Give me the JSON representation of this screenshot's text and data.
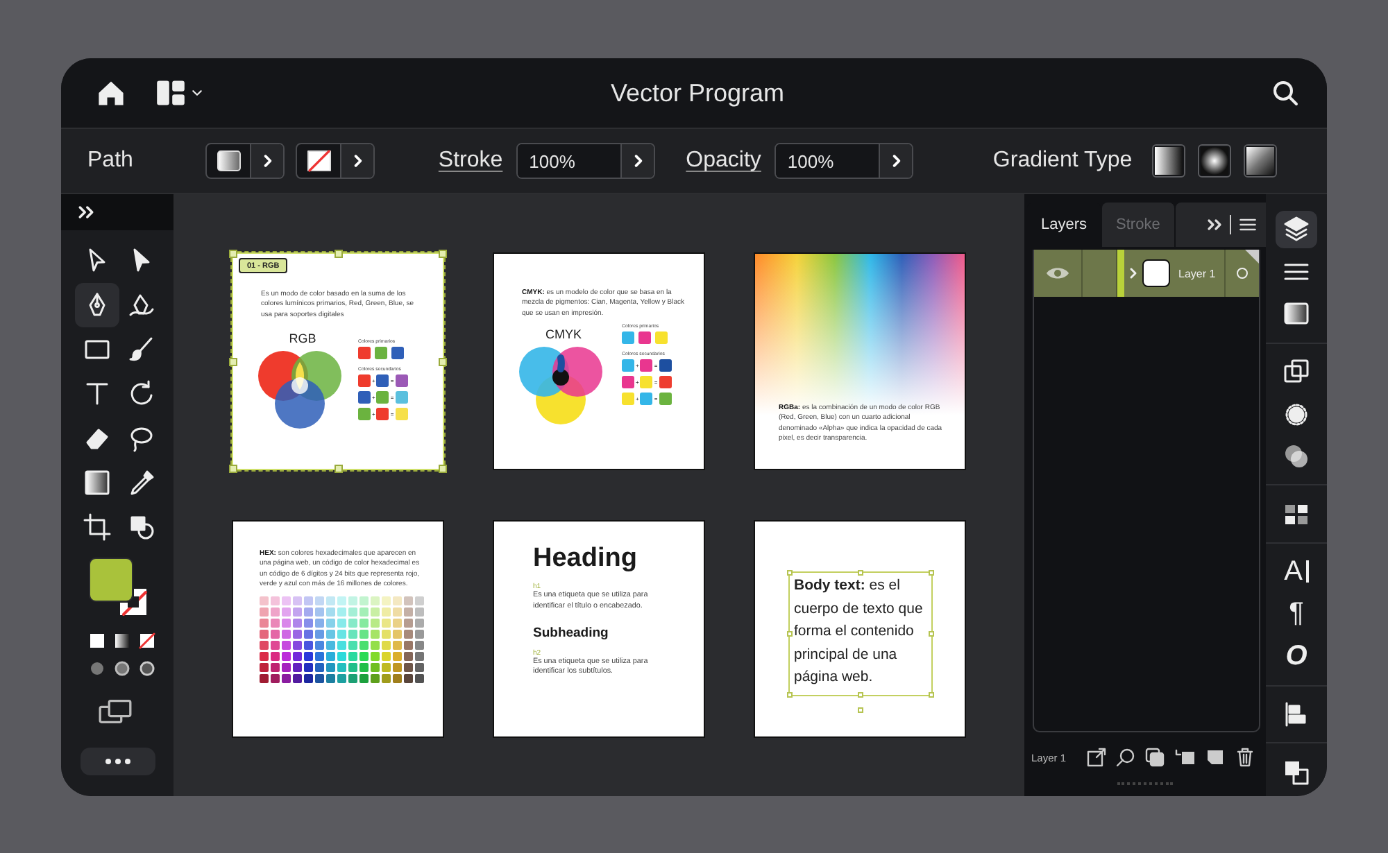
{
  "window": {
    "title": "Vector Program"
  },
  "toolbar": {
    "path_label": "Path",
    "stroke_label": "Stroke",
    "stroke_value": "100%",
    "opacity_label": "Opacity",
    "opacity_value": "100%",
    "gradient_type_label": "Gradient Type",
    "gradient_types": [
      {
        "kind": "linear"
      },
      {
        "kind": "radial"
      },
      {
        "kind": "angular"
      }
    ]
  },
  "tools": [
    {
      "kind": "select",
      "selected": false
    },
    {
      "kind": "direct-select",
      "selected": false
    },
    {
      "kind": "pen",
      "selected": true
    },
    {
      "kind": "curvature",
      "selected": false
    },
    {
      "kind": "rectangle",
      "selected": false
    },
    {
      "kind": "brush",
      "selected": false
    },
    {
      "kind": "type",
      "selected": false
    },
    {
      "kind": "rotate",
      "selected": false
    },
    {
      "kind": "eraser",
      "selected": false
    },
    {
      "kind": "lasso",
      "selected": false
    },
    {
      "kind": "gradient",
      "selected": false
    },
    {
      "kind": "eyedropper",
      "selected": false
    },
    {
      "kind": "crop",
      "selected": false
    },
    {
      "kind": "shape-builder",
      "selected": false
    }
  ],
  "artboards": [
    {
      "kind": "rgb",
      "selected": true,
      "badge": "01 - RGB",
      "text": "Es un modo de color basado en la suma de los colores lumínicos primarios, Red, Green, Blue, se usa para soportes digitales",
      "title": "RGB",
      "primary_label": "Colores primarios",
      "secondary_label": "Colores secundarios",
      "equations": [
        {
          "plus": "+",
          "equals": "="
        },
        {
          "plus": "+",
          "equals": "="
        },
        {
          "plus": "+",
          "equals": "="
        }
      ]
    },
    {
      "kind": "cmyk",
      "selected": false,
      "text": "**CMYK:** es un modelo de color que se basa en la mezcla de pigmentos: Cian, Magenta, Yellow y Black que se usan en impresión.",
      "title": "CMYK",
      "primary_label": "Colores primarios",
      "secondary_label": "Colores secundarios",
      "equations": [
        {
          "plus": "+",
          "equals": "="
        },
        {
          "plus": "+",
          "equals": "="
        },
        {
          "plus": "+",
          "equals": "="
        }
      ]
    },
    {
      "kind": "rgba",
      "selected": false,
      "text": "**RGBa:** es la combinación de un modo de color RGB (Red, Green, Blue) con un cuarto adicional denominado «Alpha» que indica la opacidad de cada pixel, es decir transparencia."
    },
    {
      "kind": "hex",
      "selected": false,
      "text": "**HEX:** son colores hexadecimales que aparecen en una página web, un código de color hexadecimal es un código de 6 dígitos y 24 bits que representa rojo, verde y azul con más de 16 millones de colores."
    },
    {
      "kind": "headings",
      "selected": false,
      "heading": "Heading",
      "h1_tag": "h1",
      "h1_text": "Es una etiqueta que se utiliza para identificar el título o encabezado.",
      "subheading": "Subheading",
      "h2_tag": "h2",
      "h2_text": "Es una etiqueta que se utiliza para identificar los subtítulos."
    },
    {
      "kind": "body",
      "selected": false,
      "text": "**Body text:** es el cuerpo de texto que forma el contenido principal de una página web.",
      "frame_selected": true
    }
  ],
  "layers_panel": {
    "tabs": [
      {
        "label": "Layers",
        "selected": true
      },
      {
        "label": "Stroke",
        "selected": false
      }
    ],
    "layers": [
      {
        "name": "Layer 1",
        "visible": true,
        "selected": true
      }
    ],
    "footer_label": "Layer 1"
  },
  "dock": [
    {
      "kind": "layers",
      "selected": true
    },
    {
      "kind": "lines",
      "selected": false
    },
    {
      "kind": "gradient",
      "selected": false
    },
    {
      "kind": "transform",
      "selected": false
    },
    {
      "kind": "appearance",
      "selected": false
    },
    {
      "kind": "pathfinder",
      "selected": false
    },
    {
      "kind": "swatches",
      "selected": false
    },
    {
      "kind": "character",
      "label": "A",
      "selected": false
    },
    {
      "kind": "paragraph",
      "label": "¶",
      "selected": false
    },
    {
      "kind": "glyphs",
      "label": "O",
      "selected": false
    },
    {
      "kind": "align",
      "selected": false
    },
    {
      "kind": "arrange",
      "selected": false
    }
  ]
}
